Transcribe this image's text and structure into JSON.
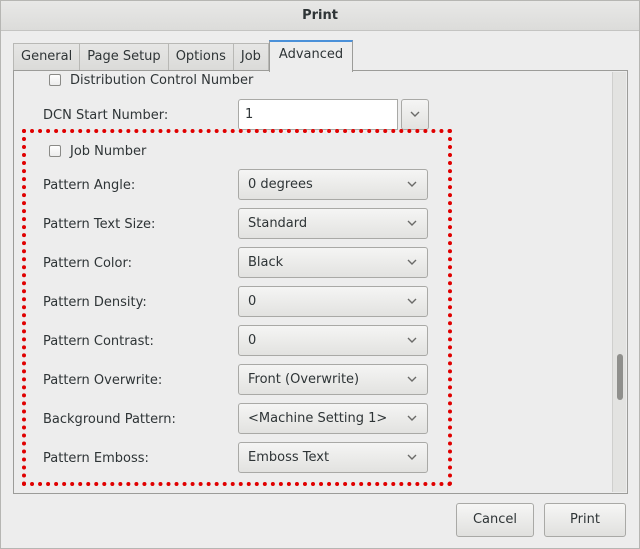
{
  "window": {
    "title": "Print"
  },
  "tabs": [
    {
      "label": "General"
    },
    {
      "label": "Page Setup"
    },
    {
      "label": "Options"
    },
    {
      "label": "Job"
    },
    {
      "label": "Advanced",
      "active": true
    }
  ],
  "advanced": {
    "distribution_control_number": {
      "label": "Distribution Control Number",
      "checked": false
    },
    "dcn_start_number": {
      "label": "DCN Start Number:",
      "value": "1"
    },
    "job_number": {
      "label": "Job Number",
      "checked": false
    },
    "fields": [
      {
        "label": "Pattern Angle:",
        "value": "0 degrees"
      },
      {
        "label": "Pattern Text Size:",
        "value": "Standard"
      },
      {
        "label": "Pattern Color:",
        "value": "Black"
      },
      {
        "label": "Pattern Density:",
        "value": "0"
      },
      {
        "label": "Pattern Contrast:",
        "value": "0"
      },
      {
        "label": "Pattern Overwrite:",
        "value": "Front (Overwrite)"
      },
      {
        "label": "Background Pattern:",
        "value": "<Machine Setting 1>"
      },
      {
        "label": "Pattern Emboss:",
        "value": "Emboss Text"
      }
    ]
  },
  "buttons": {
    "cancel": "Cancel",
    "print": "Print"
  },
  "colors": {
    "highlight_border": "#e00000",
    "active_tab_accent": "#4a90d9"
  },
  "icons": {
    "combo_arrow": "chevron-down-icon",
    "spin_arrow": "chevron-down-icon"
  }
}
